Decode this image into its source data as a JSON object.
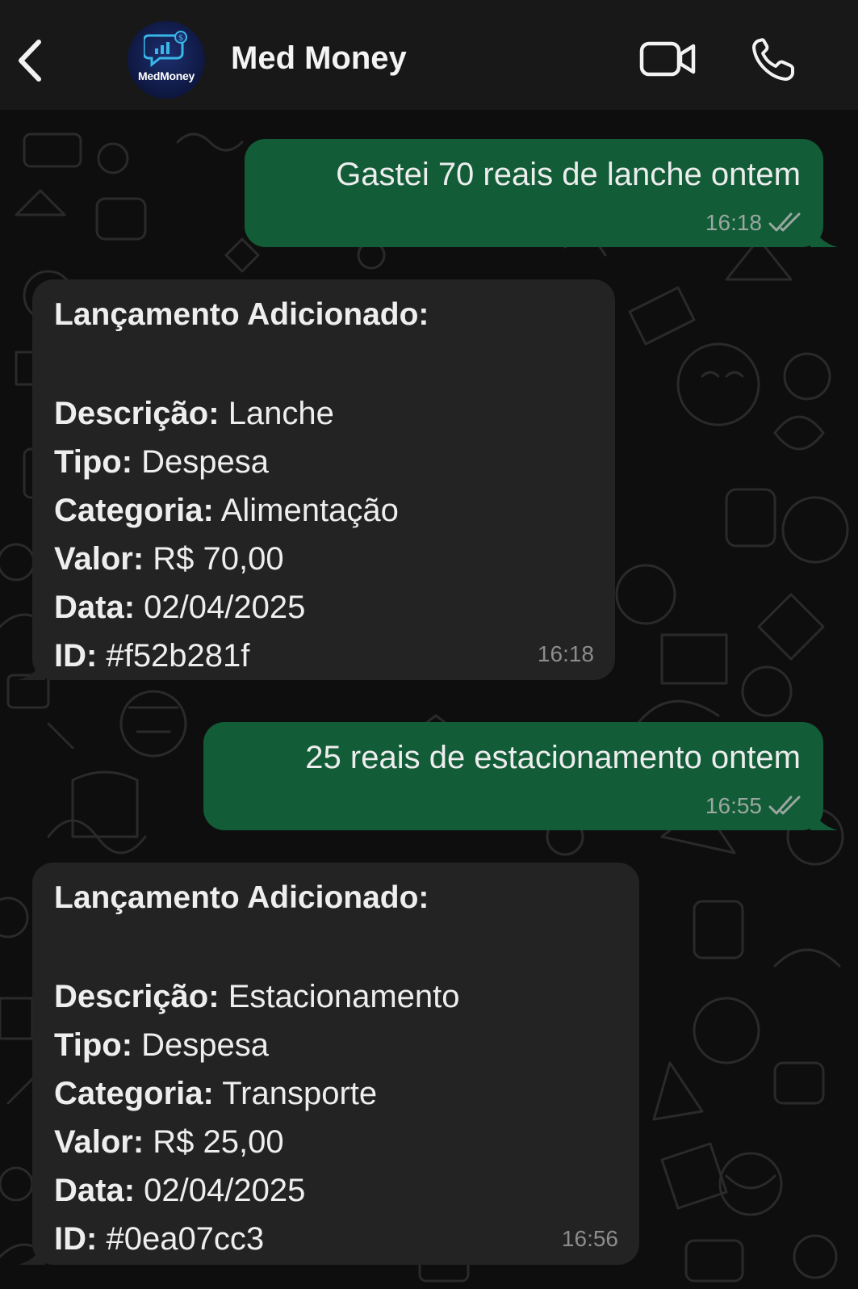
{
  "header": {
    "contact_name": "Med Money",
    "avatar_text": "MedMoney"
  },
  "messages": [
    {
      "direction": "outgoing",
      "text": "Gastei 70 reais de lanche ontem",
      "time": "16:18",
      "status": "read"
    },
    {
      "direction": "incoming",
      "title": "Lançamento Adicionado:",
      "fields": [
        {
          "label": "Descrição:",
          "value": "Lanche"
        },
        {
          "label": "Tipo:",
          "value": "Despesa"
        },
        {
          "label": "Categoria:",
          "value": " Alimentação"
        },
        {
          "label": "Valor:",
          "value": "R$ 70,00"
        },
        {
          "label": "Data:",
          "value": "02/04/2025"
        },
        {
          "label": "ID:",
          "value": "#f52b281f"
        }
      ],
      "time": "16:18"
    },
    {
      "direction": "outgoing",
      "text": "25 reais de estacionamento ontem",
      "time": "16:55",
      "status": "read"
    },
    {
      "direction": "incoming",
      "title": "Lançamento Adicionado:",
      "fields": [
        {
          "label": "Descrição:",
          "value": "Estacionamento"
        },
        {
          "label": "Tipo:",
          "value": "Despesa"
        },
        {
          "label": "Categoria:",
          "value": " Transporte"
        },
        {
          "label": "Valor:",
          "value": "R$ 25,00"
        },
        {
          "label": "Data:",
          "value": "02/04/2025"
        },
        {
          "label": "ID:",
          "value": "#0ea07cc3"
        }
      ],
      "time": "16:56"
    }
  ],
  "colors": {
    "header_bg": "#181818",
    "chat_bg": "#0e0e0e",
    "outgoing_bubble": "#125c38",
    "incoming_bubble": "#232323",
    "read_ticks": "#9aa89f"
  },
  "icons": {
    "back": "chevron-left-icon",
    "video": "video-camera-icon",
    "call": "phone-icon",
    "ticks": "double-check-icon"
  }
}
